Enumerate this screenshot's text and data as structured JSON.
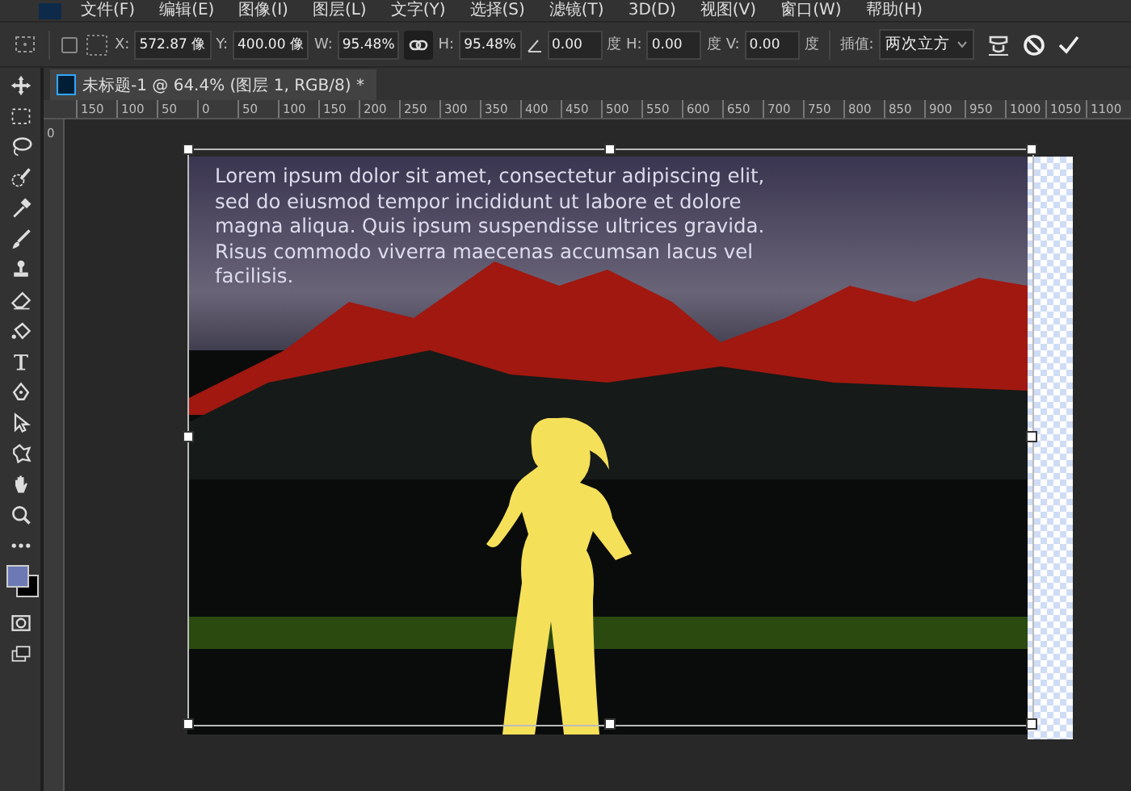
{
  "menu": [
    "文件(F)",
    "编辑(E)",
    "图像(I)",
    "图层(L)",
    "文字(Y)",
    "选择(S)",
    "滤镜(T)",
    "3D(D)",
    "视图(V)",
    "窗口(W)",
    "帮助(H)"
  ],
  "options": {
    "fields": [
      {
        "kind": "text",
        "label": "X:",
        "value": "572.87 像"
      },
      {
        "kind": "angle-label",
        "label": "Y:",
        "value": "400.00 像"
      },
      {
        "kind": "text",
        "label": "W:",
        "value": "95.48%"
      },
      {
        "kind": "link",
        "linked": true
      },
      {
        "kind": "text",
        "label": "H:",
        "value": "95.48%"
      },
      {
        "kind": "angle",
        "value": "0.00",
        "unit": "度"
      },
      {
        "kind": "text",
        "label": "H:",
        "value": "0.00",
        "unit": "度"
      },
      {
        "kind": "text",
        "label": "V:",
        "value": "0.00",
        "unit": "度"
      }
    ],
    "interpolation": {
      "label": "插值:",
      "value": "两次立方"
    }
  },
  "document_tab": {
    "title": "未标题-1 @ 64.4% (图层 1, RGB/8) *"
  },
  "ruler": {
    "labels": [
      "150",
      "100",
      "50",
      "0",
      "50",
      "100",
      "150",
      "200",
      "250",
      "300",
      "350",
      "400",
      "450",
      "500",
      "550",
      "600",
      "650",
      "700",
      "750",
      "800",
      "850",
      "900",
      "950",
      "1000",
      "1050",
      "1100"
    ],
    "vertical_labels": [
      "0"
    ]
  },
  "canvas": {
    "text": "Lorem ipsum dolor sit amet, consectetur adipiscing elit,\nsed do eiusmod tempor incididunt ut labore et dolore\nmagna aliqua. Quis ipsum suspendisse ultrices gravida.\nRisus commodo viverra maecenas accumsan lacus vel\nfacilisis."
  }
}
